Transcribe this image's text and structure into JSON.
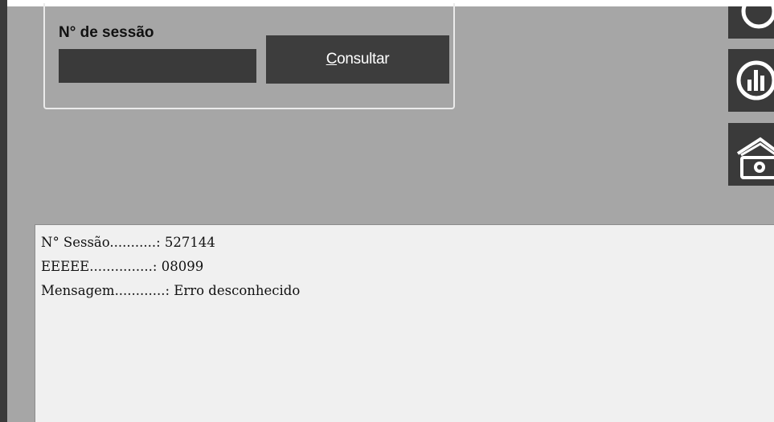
{
  "session_box": {
    "label": "N° de sessão",
    "input_value": "",
    "consult_button_mnemonic": "C",
    "consult_button_rest": "onsultar"
  },
  "side_toolbar": {
    "icons": [
      "search-icon",
      "report-icon",
      "bank-money-icon"
    ]
  },
  "output": {
    "lines": [
      "N° Sessão...........: 527144",
      "EEEEE...............: 08099",
      "Mensagem............: Erro desconhecido"
    ]
  },
  "colors": {
    "background": "#a6a6a6",
    "dark_control": "#3a3a3a",
    "output_background": "#f0f0f0"
  }
}
